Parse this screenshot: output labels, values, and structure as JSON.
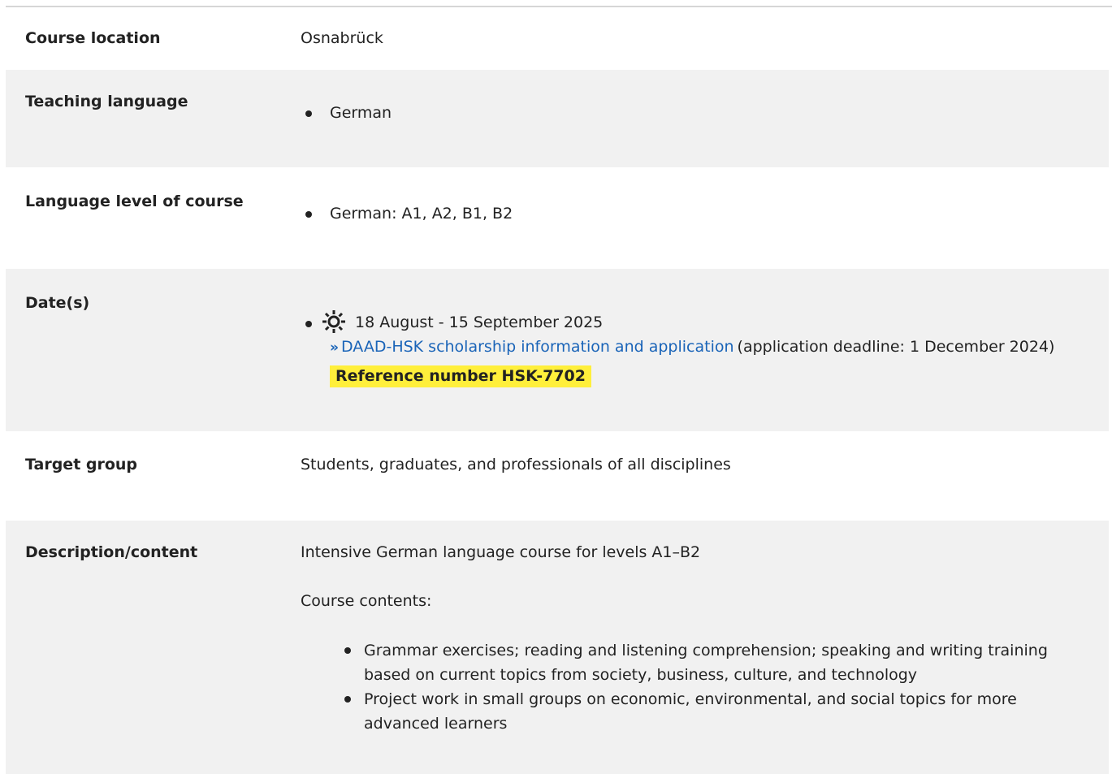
{
  "course_location": {
    "label": "Course location",
    "value": "Osnabrück"
  },
  "teaching_language": {
    "label": "Teaching language",
    "items": [
      "German"
    ]
  },
  "language_level": {
    "label": "Language level of course",
    "items": [
      "German: A1, A2, B1, B2"
    ]
  },
  "dates": {
    "label": "Date(s)",
    "season_icon": "sun-icon",
    "date_range": "18 August - 15 September 2025",
    "link_text": "DAAD-HSK scholarship information and application",
    "deadline_text": "(application deadline: 1 December 2024)",
    "reference": "Reference number HSK-7702"
  },
  "target_group": {
    "label": "Target group",
    "value": "Students, graduates, and professionals of all disciplines"
  },
  "description": {
    "label": "Description/content",
    "intro": "Intensive German language course for levels A1–B2",
    "contents_heading": "Course contents:",
    "items": [
      "Grammar exercises; reading and listening comprehension; speaking and writing training based on current topics from society, business, culture, and technology",
      "Project work in small groups on economic, environmental, and social topics for more advanced learners"
    ]
  },
  "colors": {
    "row_shade": "#f1f1f1",
    "link": "#1a64b8",
    "highlight": "#ffef3b"
  }
}
